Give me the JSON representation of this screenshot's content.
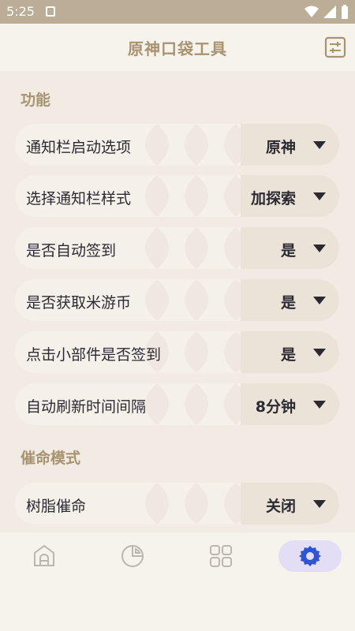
{
  "status_bar": {
    "time": "5:25"
  },
  "app_bar": {
    "title": "原神口袋工具"
  },
  "sections": [
    {
      "title": "功能",
      "items": [
        {
          "label": "通知栏启动选项",
          "value": "原神"
        },
        {
          "label": "选择通知栏样式",
          "value": "加探索"
        },
        {
          "label": "是否自动签到",
          "value": "是"
        },
        {
          "label": "是否获取米游币",
          "value": "是"
        },
        {
          "label": "点击小部件是否签到",
          "value": "是"
        },
        {
          "label": "自动刷新时间间隔",
          "value": "8分钟"
        }
      ]
    },
    {
      "title": "催命模式",
      "items": [
        {
          "label": "树脂催命",
          "value": "关闭"
        }
      ]
    }
  ],
  "bottom_nav": {
    "items": [
      {
        "icon": "home-icon"
      },
      {
        "icon": "pie-chart-icon"
      },
      {
        "icon": "grid-icon"
      },
      {
        "icon": "gear-icon",
        "active": true
      }
    ]
  },
  "colors": {
    "status_bar": "#bcad96",
    "accent_gold": "#a89370",
    "page_bg": "#f1ebe4",
    "row_bg": "#f5f1ea",
    "value_bg": "#ece3d8",
    "text_dark": "#2b2a33",
    "active_nav_bg": "#e4ddf6",
    "active_nav_icon": "#2f55d4"
  }
}
